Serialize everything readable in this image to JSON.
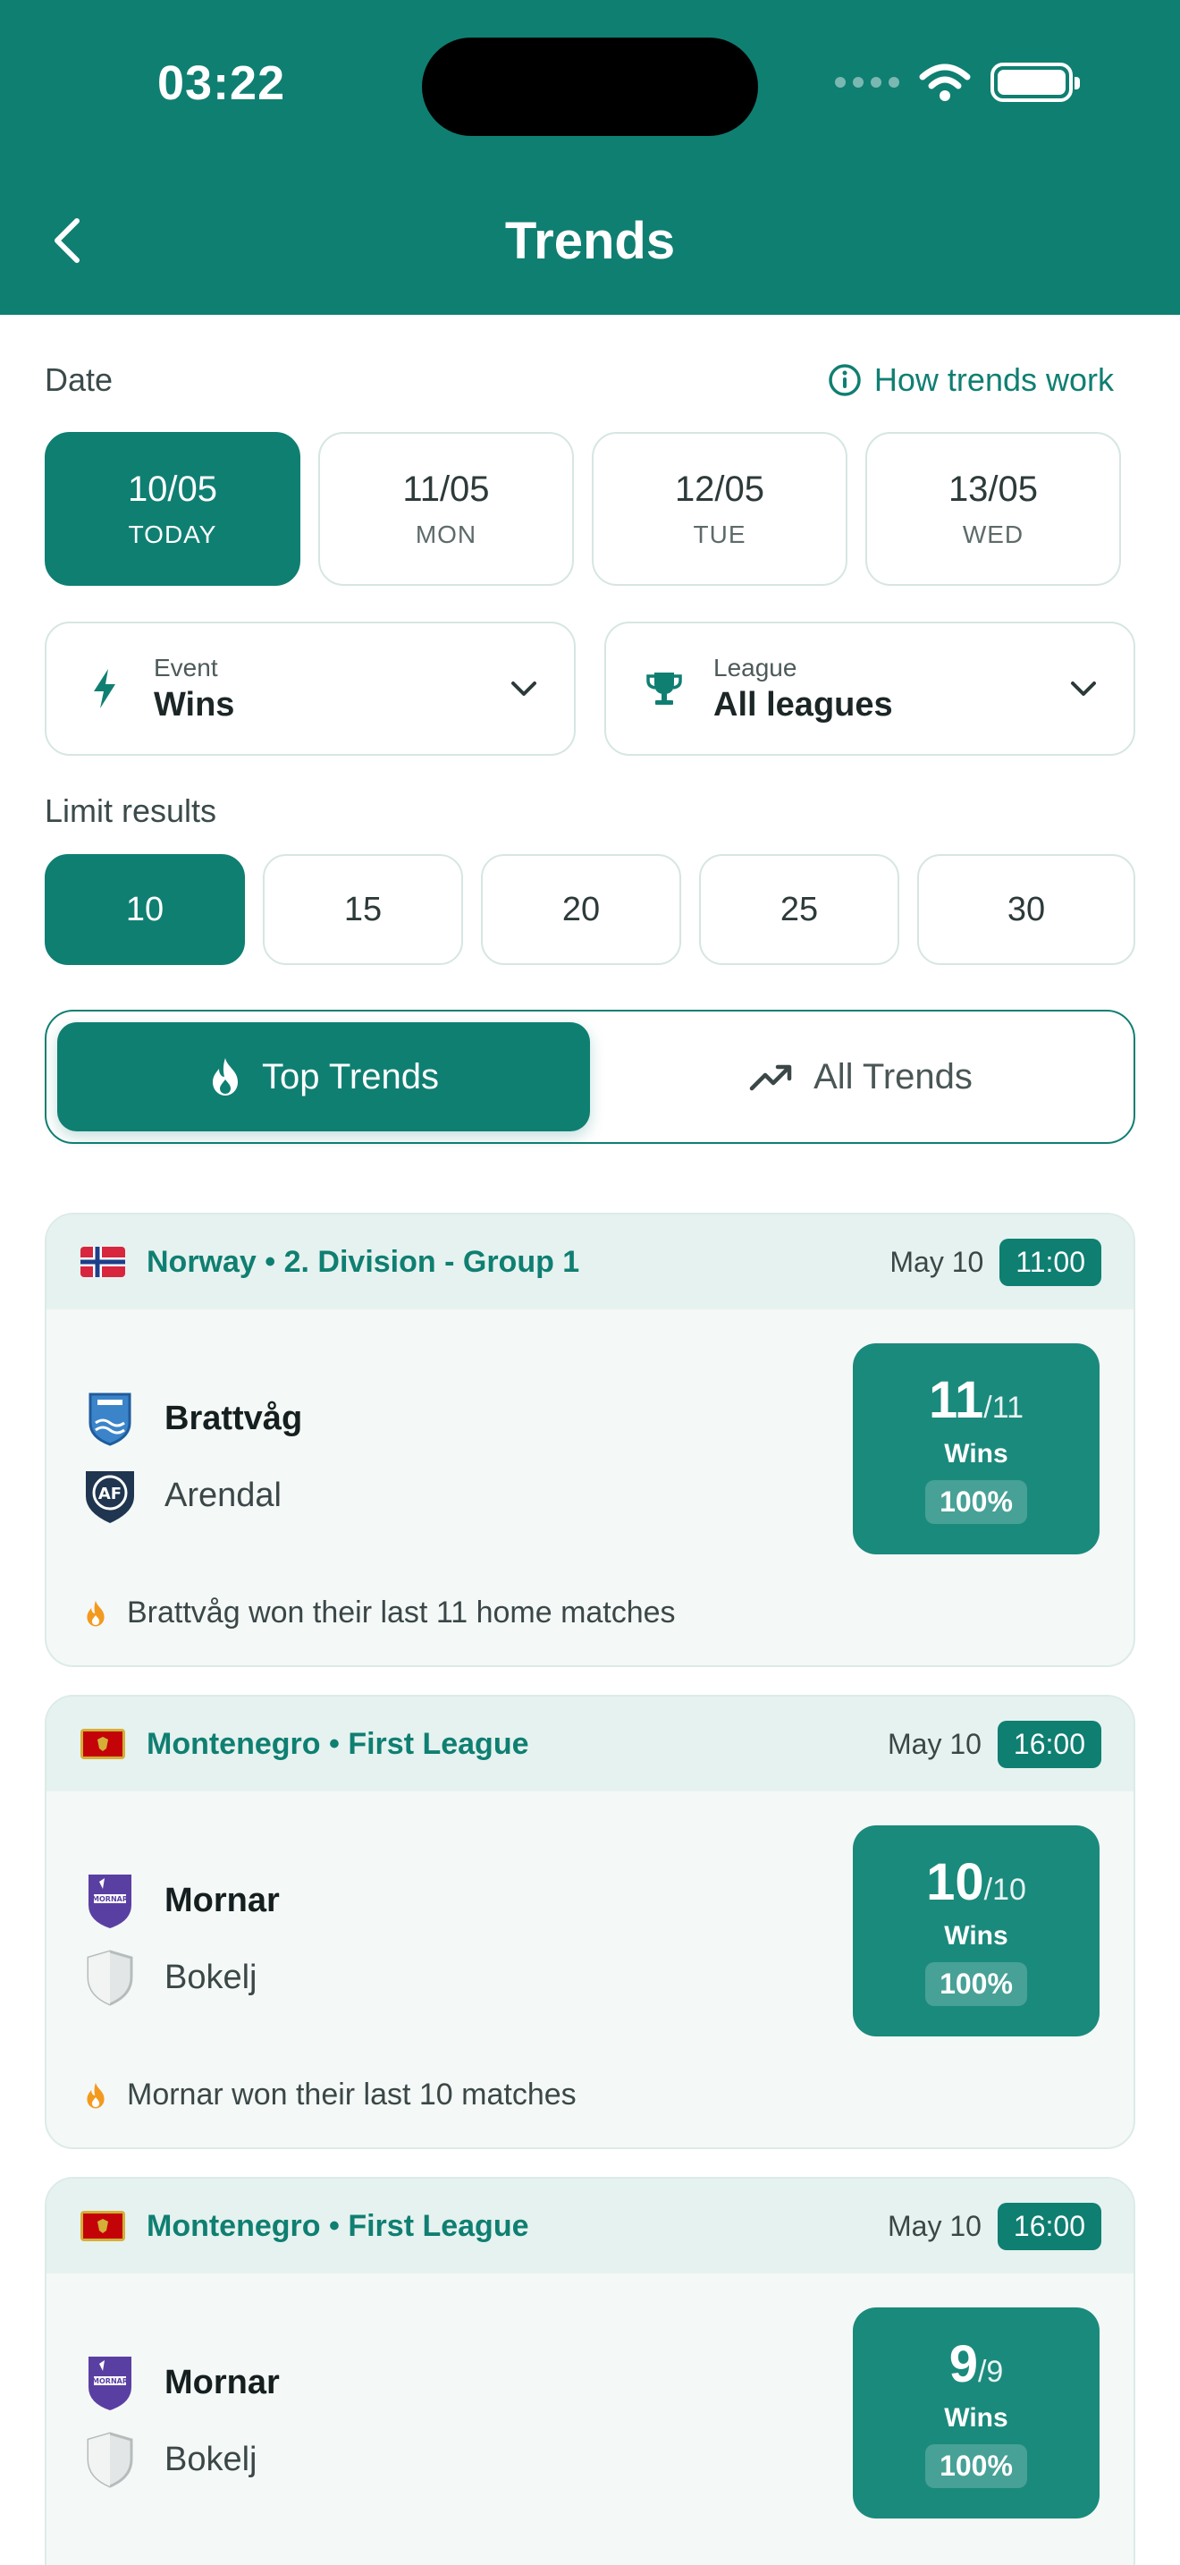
{
  "status_bar": {
    "time": "03:22"
  },
  "header": {
    "title": "Trends"
  },
  "date_section": {
    "label": "Date",
    "help_link": "How trends work",
    "dates": [
      {
        "date": "10/05",
        "weekday": "TODAY",
        "selected": true
      },
      {
        "date": "11/05",
        "weekday": "MON",
        "selected": false
      },
      {
        "date": "12/05",
        "weekday": "TUE",
        "selected": false
      },
      {
        "date": "13/05",
        "weekday": "WED",
        "selected": false
      }
    ]
  },
  "filters": {
    "event": {
      "label": "Event",
      "value": "Wins"
    },
    "league": {
      "label": "League",
      "value": "All leagues"
    }
  },
  "limit_section": {
    "label": "Limit results",
    "options": [
      "10",
      "15",
      "20",
      "25",
      "30"
    ],
    "selected": "10"
  },
  "segment": {
    "top_trends": "Top Trends",
    "all_trends": "All Trends",
    "selected": "top_trends"
  },
  "cards": [
    {
      "league": "Norway • 2. Division - Group 1",
      "flag": "norway",
      "date": "May 10",
      "time": "11:00",
      "home": "Brattvåg",
      "away": "Arendal",
      "count": "11",
      "total": "/11",
      "stat_label": "Wins",
      "percent": "100%",
      "note": "Brattvåg won their last 11 home matches"
    },
    {
      "league": "Montenegro • First League",
      "flag": "montenegro",
      "date": "May 10",
      "time": "16:00",
      "home": "Mornar",
      "away": "Bokelj",
      "count": "10",
      "total": "/10",
      "stat_label": "Wins",
      "percent": "100%",
      "note": "Mornar won their last 10 matches"
    },
    {
      "league": "Montenegro • First League",
      "flag": "montenegro",
      "date": "May 10",
      "time": "16:00",
      "home": "Mornar",
      "away": "Bokelj",
      "count": "9",
      "total": "/9",
      "stat_label": "Wins",
      "percent": "100%",
      "note": ""
    }
  ],
  "colors": {
    "primary": "#0f7f72",
    "stat_box": "#1a8a7c",
    "flame": "#f39a1e"
  },
  "icons": [
    "back-arrow-icon",
    "info-icon",
    "lightning-icon",
    "trophy-icon",
    "chevron-down-icon",
    "flame-icon",
    "trend-up-icon",
    "wifi-icon",
    "battery-icon"
  ]
}
